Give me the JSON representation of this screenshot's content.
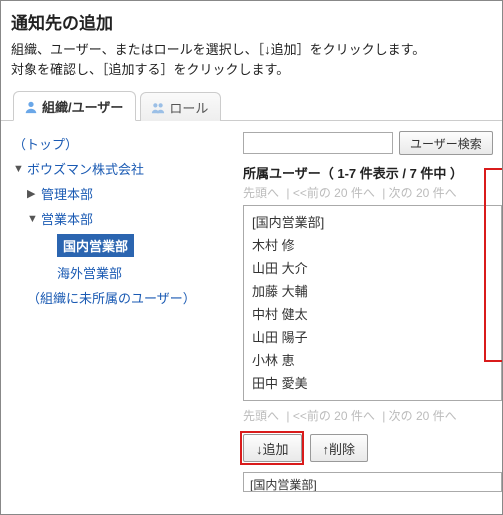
{
  "header": {
    "title": "通知先の追加",
    "desc1": "組織、ユーザー、またはロールを選択し、［↓追加］をクリックします。",
    "desc2": "対象を確認し、［追加する］をクリックします。"
  },
  "tabs": {
    "org_users": "組織/ユーザー",
    "roles": "ロール"
  },
  "tree": {
    "top": "（トップ）",
    "company": "ボウズマン株式会社",
    "dept1": "管理本部",
    "dept2": "営業本部",
    "sub1": "国内営業部",
    "sub2": "海外営業部",
    "unassigned": "（組織に未所属のユーザー）"
  },
  "search": {
    "placeholder": "",
    "button": "ユーザー検索"
  },
  "userlist": {
    "title": "所属ユーザー（ 1-7 件表示 / 7 件中 ）",
    "pager_top_1": "先頭へ",
    "pager_top_2": "<<前の 20 件へ",
    "pager_top_3": "次の 20 件へ",
    "items": [
      "[国内営業部]",
      "木村 修",
      "山田 大介",
      "加藤 大輔",
      "中村 健太",
      "山田 陽子",
      "小林 恵",
      "田中 愛美"
    ],
    "pager_bot_1": "先頭へ",
    "pager_bot_2": "<<前の 20 件へ",
    "pager_bot_3": "次の 20 件へ"
  },
  "actions": {
    "add": "↓追加",
    "remove": "↑削除"
  },
  "resultbox": {
    "item0": "[国内営業部]"
  }
}
